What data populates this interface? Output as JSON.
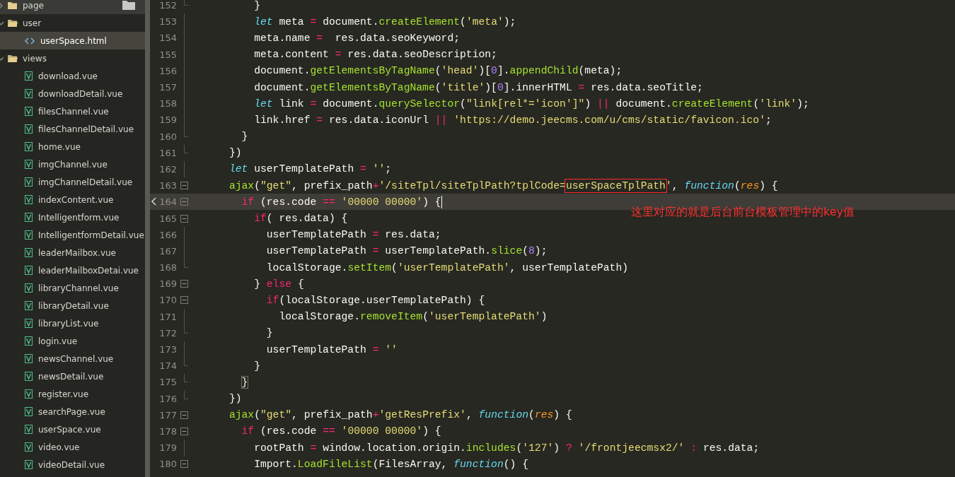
{
  "sidebar": {
    "items": [
      {
        "name": "page",
        "kind": "folder",
        "expanded": false,
        "selected": false,
        "hovered": true
      },
      {
        "name": "user",
        "kind": "folder",
        "expanded": true,
        "selected": false,
        "hovered": false,
        "children": [
          {
            "name": "userSpace.html",
            "kind": "html",
            "selected": true,
            "hovered": false
          }
        ]
      },
      {
        "name": "views",
        "kind": "folder",
        "expanded": true,
        "selected": false,
        "hovered": false,
        "children": [
          {
            "name": "download.vue",
            "kind": "vue",
            "selected": false,
            "hovered": false
          },
          {
            "name": "downloadDetail.vue",
            "kind": "vue",
            "selected": false,
            "hovered": false
          },
          {
            "name": "filesChannel.vue",
            "kind": "vue",
            "selected": false,
            "hovered": false
          },
          {
            "name": "filesChannelDetail.vue",
            "kind": "vue",
            "selected": false,
            "hovered": false
          },
          {
            "name": "home.vue",
            "kind": "vue",
            "selected": false,
            "hovered": false
          },
          {
            "name": "imgChannel.vue",
            "kind": "vue",
            "selected": false,
            "hovered": false
          },
          {
            "name": "imgChannelDetail.vue",
            "kind": "vue",
            "selected": false,
            "hovered": false
          },
          {
            "name": "indexContent.vue",
            "kind": "vue",
            "selected": false,
            "hovered": false
          },
          {
            "name": "Intelligentform.vue",
            "kind": "vue",
            "selected": false,
            "hovered": false
          },
          {
            "name": "IntelligentformDetail.vue",
            "kind": "vue",
            "selected": false,
            "hovered": false
          },
          {
            "name": "leaderMailbox.vue",
            "kind": "vue",
            "selected": false,
            "hovered": false
          },
          {
            "name": "leaderMailboxDetai.vue",
            "kind": "vue",
            "selected": false,
            "hovered": false
          },
          {
            "name": "libraryChannel.vue",
            "kind": "vue",
            "selected": false,
            "hovered": false
          },
          {
            "name": "libraryDetail.vue",
            "kind": "vue",
            "selected": false,
            "hovered": false
          },
          {
            "name": "libraryList.vue",
            "kind": "vue",
            "selected": false,
            "hovered": false
          },
          {
            "name": "login.vue",
            "kind": "vue",
            "selected": false,
            "hovered": false
          },
          {
            "name": "newsChannel.vue",
            "kind": "vue",
            "selected": false,
            "hovered": false
          },
          {
            "name": "newsDetail.vue",
            "kind": "vue",
            "selected": false,
            "hovered": false
          },
          {
            "name": "register.vue",
            "kind": "vue",
            "selected": false,
            "hovered": false
          },
          {
            "name": "searchPage.vue",
            "kind": "vue",
            "selected": false,
            "hovered": false
          },
          {
            "name": "userSpace.vue",
            "kind": "vue",
            "selected": false,
            "hovered": false
          },
          {
            "name": "video.vue",
            "kind": "vue",
            "selected": false,
            "hovered": false
          },
          {
            "name": "videoDetail.vue",
            "kind": "vue",
            "selected": false,
            "hovered": false
          }
        ]
      }
    ]
  },
  "editor": {
    "lines": [
      {
        "number": "152",
        "kind": "fold-end",
        "selected": false,
        "tokens": [
          {
            "kind": "plain",
            "text": "          }"
          }
        ]
      },
      {
        "number": "153",
        "kind": "fold-inner",
        "selected": false,
        "tokens": [
          {
            "kind": "storage",
            "text": "          let"
          },
          {
            "kind": "plain",
            "text": " meta "
          },
          {
            "kind": "keyword",
            "text": "="
          },
          {
            "kind": "plain",
            "text": " document."
          },
          {
            "kind": "function",
            "text": "createElement"
          },
          {
            "kind": "plain",
            "text": "("
          },
          {
            "kind": "string",
            "text": "'meta'"
          },
          {
            "kind": "plain",
            "text": ");"
          }
        ]
      },
      {
        "number": "154",
        "kind": "fold-inner",
        "selected": false,
        "tokens": [
          {
            "kind": "plain",
            "text": "          meta.name "
          },
          {
            "kind": "keyword",
            "text": "="
          },
          {
            "kind": "plain",
            "text": "  res.data.seoKeyword;"
          }
        ]
      },
      {
        "number": "155",
        "kind": "fold-inner",
        "selected": false,
        "tokens": [
          {
            "kind": "plain",
            "text": "          meta.content "
          },
          {
            "kind": "keyword",
            "text": "="
          },
          {
            "kind": "plain",
            "text": " res.data.seoDescription;"
          }
        ]
      },
      {
        "number": "156",
        "kind": "fold-inner",
        "selected": false,
        "tokens": [
          {
            "kind": "plain",
            "text": "          document."
          },
          {
            "kind": "function",
            "text": "getElementsByTagName"
          },
          {
            "kind": "plain",
            "text": "("
          },
          {
            "kind": "string",
            "text": "'head'"
          },
          {
            "kind": "plain",
            "text": ")["
          },
          {
            "kind": "number",
            "text": "0"
          },
          {
            "kind": "plain",
            "text": "]."
          },
          {
            "kind": "function",
            "text": "appendChild"
          },
          {
            "kind": "plain",
            "text": "(meta);"
          }
        ]
      },
      {
        "number": "157",
        "kind": "fold-inner",
        "selected": false,
        "tokens": [
          {
            "kind": "plain",
            "text": "          document."
          },
          {
            "kind": "function",
            "text": "getElementsByTagName"
          },
          {
            "kind": "plain",
            "text": "("
          },
          {
            "kind": "string",
            "text": "'title'"
          },
          {
            "kind": "plain",
            "text": ")["
          },
          {
            "kind": "number",
            "text": "0"
          },
          {
            "kind": "plain",
            "text": "].innerHTML "
          },
          {
            "kind": "keyword",
            "text": "="
          },
          {
            "kind": "plain",
            "text": " res.data.seoTitle;"
          }
        ]
      },
      {
        "number": "158",
        "kind": "fold-inner",
        "selected": false,
        "tokens": [
          {
            "kind": "storage",
            "text": "          let"
          },
          {
            "kind": "plain",
            "text": " link "
          },
          {
            "kind": "keyword",
            "text": "="
          },
          {
            "kind": "plain",
            "text": " document."
          },
          {
            "kind": "function",
            "text": "querySelector"
          },
          {
            "kind": "plain",
            "text": "("
          },
          {
            "kind": "string",
            "text": "\"link[rel*='icon']\""
          },
          {
            "kind": "plain",
            "text": ") "
          },
          {
            "kind": "keyword",
            "text": "||"
          },
          {
            "kind": "plain",
            "text": " document."
          },
          {
            "kind": "function",
            "text": "createElement"
          },
          {
            "kind": "plain",
            "text": "("
          },
          {
            "kind": "string",
            "text": "'link'"
          },
          {
            "kind": "plain",
            "text": ");"
          }
        ]
      },
      {
        "number": "159",
        "kind": "fold-inner",
        "selected": false,
        "tokens": [
          {
            "kind": "plain",
            "text": "          link.href "
          },
          {
            "kind": "keyword",
            "text": "="
          },
          {
            "kind": "plain",
            "text": " res.data.iconUrl "
          },
          {
            "kind": "keyword",
            "text": "||"
          },
          {
            "kind": "string",
            "text": " 'https://demo.jeecms.com/u/cms/static/favicon.ico'"
          },
          {
            "kind": "plain",
            "text": ";"
          }
        ]
      },
      {
        "number": "160",
        "kind": "fold-end",
        "selected": false,
        "tokens": [
          {
            "kind": "plain",
            "text": "        }"
          }
        ]
      },
      {
        "number": "161",
        "kind": "fold-end",
        "selected": false,
        "tokens": [
          {
            "kind": "plain",
            "text": "      })"
          }
        ]
      },
      {
        "number": "162",
        "kind": "fold-inner",
        "selected": false,
        "tokens": [
          {
            "kind": "storage",
            "text": "      let"
          },
          {
            "kind": "plain",
            "text": " userTemplatePath "
          },
          {
            "kind": "keyword",
            "text": "="
          },
          {
            "kind": "string",
            "text": " ''"
          },
          {
            "kind": "plain",
            "text": ";"
          }
        ]
      },
      {
        "number": "163",
        "kind": "fold-start",
        "selected": false,
        "tokens": [
          {
            "kind": "function",
            "text": "      ajax"
          },
          {
            "kind": "plain",
            "text": "("
          },
          {
            "kind": "string",
            "text": "\"get\""
          },
          {
            "kind": "plain",
            "text": ", prefix_path"
          },
          {
            "kind": "keyword",
            "text": "+"
          },
          {
            "kind": "string",
            "text": "'/siteTpl/siteTplPath?tplCode="
          },
          {
            "kind": "marked",
            "text": "userSpaceTplPath"
          },
          {
            "kind": "string",
            "text": "'"
          },
          {
            "kind": "plain",
            "text": ", "
          },
          {
            "kind": "storage",
            "text": "function"
          },
          {
            "kind": "plain",
            "text": "("
          },
          {
            "kind": "param",
            "text": "res"
          },
          {
            "kind": "plain",
            "text": ") {"
          }
        ]
      },
      {
        "number": "164",
        "kind": "fold-start",
        "selected": true,
        "tokens": [
          {
            "kind": "keyword",
            "text": "        if"
          },
          {
            "kind": "plain",
            "text": " (res.code "
          },
          {
            "kind": "keyword",
            "text": "=="
          },
          {
            "kind": "string",
            "text": " '00000 00000'"
          },
          {
            "kind": "plain",
            "text": ") {"
          }
        ]
      },
      {
        "number": "165",
        "kind": "fold-start",
        "selected": false,
        "tokens": [
          {
            "kind": "keyword",
            "text": "          if"
          },
          {
            "kind": "plain",
            "text": "( res.data) {"
          }
        ]
      },
      {
        "number": "166",
        "kind": "fold-inner",
        "selected": false,
        "tokens": [
          {
            "kind": "plain",
            "text": "            userTemplatePath "
          },
          {
            "kind": "keyword",
            "text": "="
          },
          {
            "kind": "plain",
            "text": " res.data;"
          }
        ]
      },
      {
        "number": "167",
        "kind": "fold-inner",
        "selected": false,
        "tokens": [
          {
            "kind": "plain",
            "text": "            userTemplatePath "
          },
          {
            "kind": "keyword",
            "text": "="
          },
          {
            "kind": "plain",
            "text": " userTemplatePath."
          },
          {
            "kind": "function",
            "text": "slice"
          },
          {
            "kind": "plain",
            "text": "("
          },
          {
            "kind": "number",
            "text": "8"
          },
          {
            "kind": "plain",
            "text": ");"
          }
        ]
      },
      {
        "number": "168",
        "kind": "fold-end",
        "selected": false,
        "tokens": [
          {
            "kind": "plain",
            "text": "            localStorage."
          },
          {
            "kind": "function",
            "text": "setItem"
          },
          {
            "kind": "plain",
            "text": "("
          },
          {
            "kind": "string",
            "text": "'userTemplatePath'"
          },
          {
            "kind": "plain",
            "text": ", userTemplatePath)"
          }
        ]
      },
      {
        "number": "169",
        "kind": "fold-start",
        "selected": false,
        "tokens": [
          {
            "kind": "plain",
            "text": "          } "
          },
          {
            "kind": "keyword",
            "text": "else"
          },
          {
            "kind": "plain",
            "text": " {"
          }
        ]
      },
      {
        "number": "170",
        "kind": "fold-start",
        "selected": false,
        "tokens": [
          {
            "kind": "keyword",
            "text": "            if"
          },
          {
            "kind": "plain",
            "text": "(localStorage.userTemplatePath) {"
          }
        ]
      },
      {
        "number": "171",
        "kind": "fold-inner",
        "selected": false,
        "tokens": [
          {
            "kind": "plain",
            "text": "              localStorage."
          },
          {
            "kind": "function",
            "text": "removeItem"
          },
          {
            "kind": "plain",
            "text": "("
          },
          {
            "kind": "string",
            "text": "'userTemplatePath'"
          },
          {
            "kind": "plain",
            "text": ")"
          }
        ]
      },
      {
        "number": "172",
        "kind": "fold-end",
        "selected": false,
        "tokens": [
          {
            "kind": "plain",
            "text": "            }"
          }
        ]
      },
      {
        "number": "173",
        "kind": "fold-inner",
        "selected": false,
        "tokens": [
          {
            "kind": "plain",
            "text": "            userTemplatePath "
          },
          {
            "kind": "keyword",
            "text": "="
          },
          {
            "kind": "string",
            "text": " ''"
          }
        ]
      },
      {
        "number": "174",
        "kind": "fold-end",
        "selected": false,
        "tokens": [
          {
            "kind": "plain",
            "text": "          }"
          }
        ]
      },
      {
        "number": "175",
        "kind": "fold-end",
        "selected": false,
        "tokens": [
          {
            "kind": "match",
            "text": "        }"
          }
        ]
      },
      {
        "number": "176",
        "kind": "fold-end",
        "selected": false,
        "tokens": [
          {
            "kind": "plain",
            "text": "      })"
          }
        ]
      },
      {
        "number": "177",
        "kind": "fold-start",
        "selected": false,
        "tokens": [
          {
            "kind": "function",
            "text": "      ajax"
          },
          {
            "kind": "plain",
            "text": "("
          },
          {
            "kind": "string",
            "text": "\"get\""
          },
          {
            "kind": "plain",
            "text": ", prefix_path"
          },
          {
            "kind": "keyword",
            "text": "+"
          },
          {
            "kind": "string",
            "text": "'getResPrefix'"
          },
          {
            "kind": "plain",
            "text": ", "
          },
          {
            "kind": "storage",
            "text": "function"
          },
          {
            "kind": "plain",
            "text": "("
          },
          {
            "kind": "param",
            "text": "res"
          },
          {
            "kind": "plain",
            "text": ") {"
          }
        ]
      },
      {
        "number": "178",
        "kind": "fold-start",
        "selected": false,
        "tokens": [
          {
            "kind": "keyword",
            "text": "        if"
          },
          {
            "kind": "plain",
            "text": " (res.code "
          },
          {
            "kind": "keyword",
            "text": "=="
          },
          {
            "kind": "string",
            "text": " '00000 00000'"
          },
          {
            "kind": "plain",
            "text": ") {"
          }
        ]
      },
      {
        "number": "179",
        "kind": "fold-inner",
        "selected": false,
        "tokens": [
          {
            "kind": "plain",
            "text": "          rootPath "
          },
          {
            "kind": "keyword",
            "text": "="
          },
          {
            "kind": "plain",
            "text": " window.location.origin."
          },
          {
            "kind": "function",
            "text": "includes"
          },
          {
            "kind": "plain",
            "text": "("
          },
          {
            "kind": "string",
            "text": "'127'"
          },
          {
            "kind": "plain",
            "text": ") "
          },
          {
            "kind": "keyword",
            "text": "?"
          },
          {
            "kind": "string",
            "text": " '/frontjeecmsx2/'"
          },
          {
            "kind": "keyword",
            "text": " :"
          },
          {
            "kind": "plain",
            "text": " res.data;"
          }
        ]
      },
      {
        "number": "180",
        "kind": "fold-start",
        "selected": false,
        "tokens": [
          {
            "kind": "plain",
            "text": "          Import."
          },
          {
            "kind": "function",
            "text": "LoadFileList"
          },
          {
            "kind": "plain",
            "text": "(FilesArray, "
          },
          {
            "kind": "storage",
            "text": "function"
          },
          {
            "kind": "plain",
            "text": "() {"
          }
        ]
      }
    ],
    "annotation": "这里对应的就是后台前台模板管理中的key值"
  }
}
